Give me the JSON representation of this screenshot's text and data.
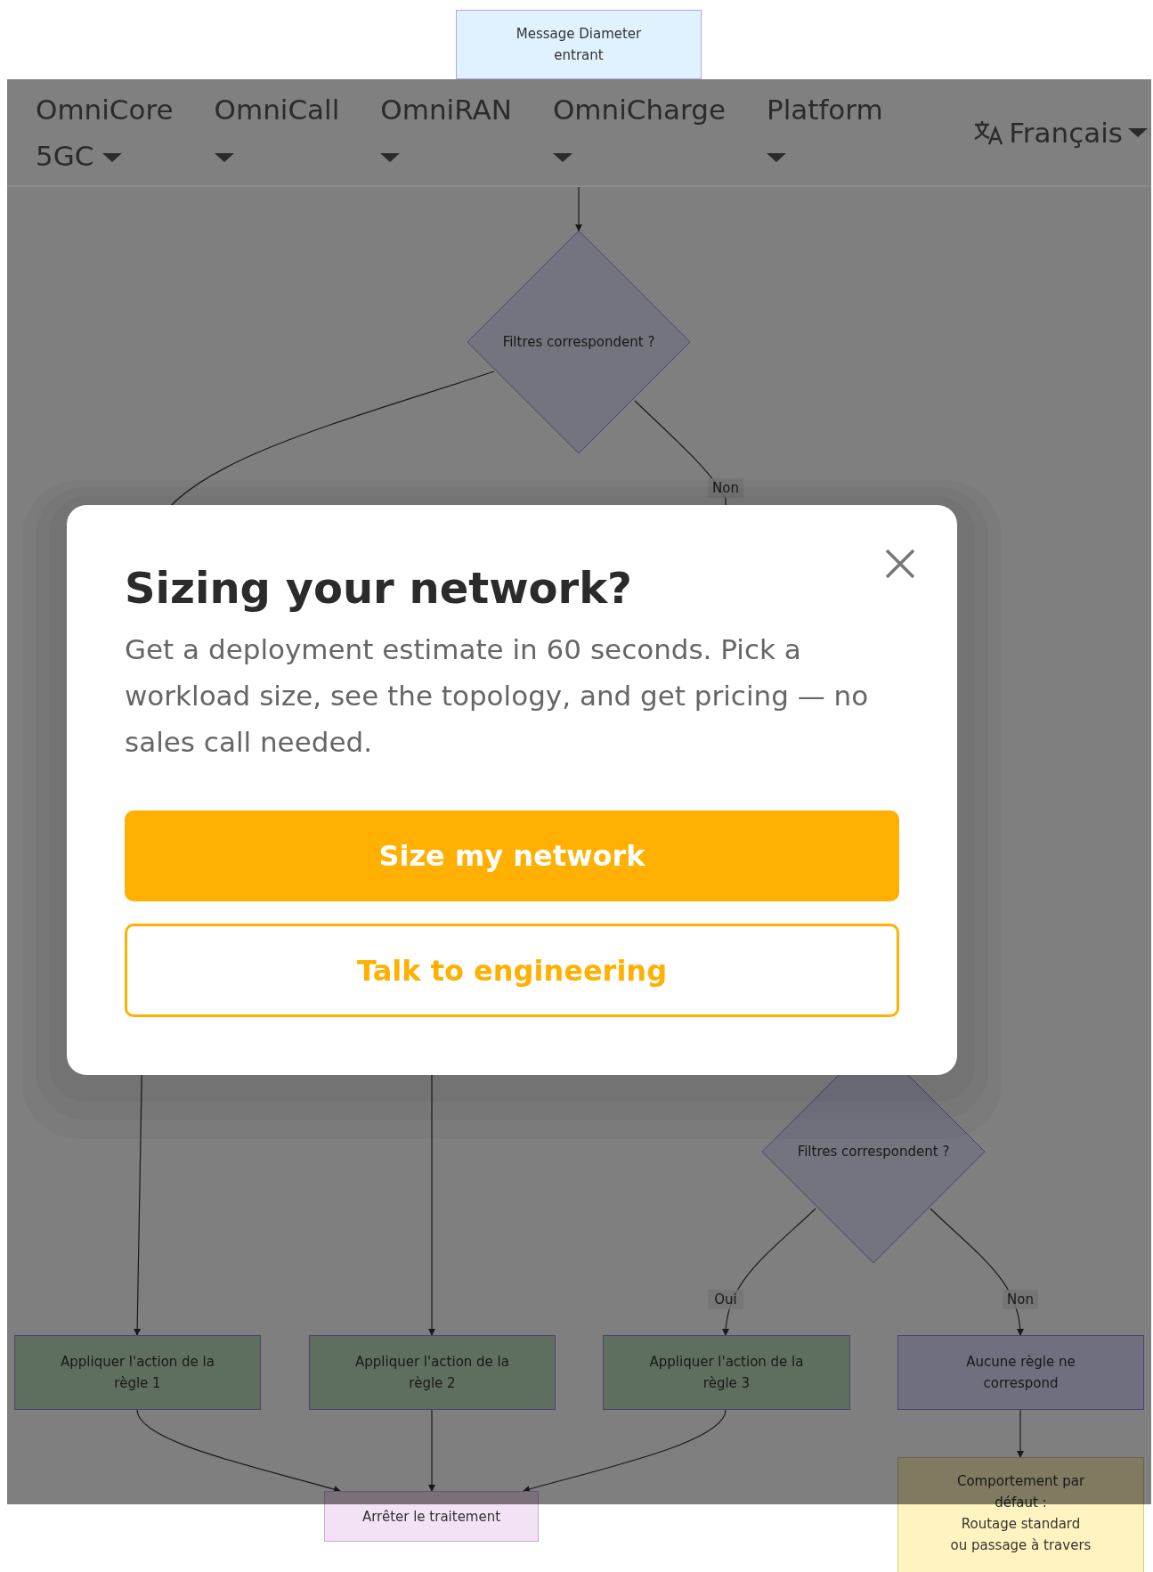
{
  "diagram": {
    "nodes": [
      {
        "kind": "start",
        "text": "Message Diameter entrant"
      },
      {
        "kind": "decision",
        "text": "Filtres correspondent ?"
      },
      {
        "kind": "decision",
        "text": "Filtres correspondent ?"
      },
      {
        "kind": "action",
        "text": "Appliquer l'action de la règle 1"
      },
      {
        "kind": "action",
        "text": "Appliquer l'action de la règle 2"
      },
      {
        "kind": "action",
        "text": "Appliquer l'action de la règle 3"
      },
      {
        "kind": "fallback",
        "text": "Aucune règle ne correspond"
      },
      {
        "kind": "stop",
        "text": "Arrêter le traitement"
      },
      {
        "kind": "default",
        "lines": [
          "Comportement par défaut :",
          "Routage standard",
          "ou passage à travers"
        ]
      }
    ],
    "edge_labels": [
      {
        "text": "Non"
      },
      {
        "text": "Oui"
      },
      {
        "text": "Non"
      }
    ]
  },
  "nav": {
    "items": [
      {
        "label": "OmniCore 5GC"
      },
      {
        "label": "OmniCall"
      },
      {
        "label": "OmniRAN"
      },
      {
        "label": "OmniCharge"
      },
      {
        "label": "Platform"
      }
    ],
    "language": {
      "label": "Français"
    }
  },
  "modal": {
    "title": "Sizing your network?",
    "body": "Get a deployment estimate in 60 seconds. Pick a workload size, see the topology, and get pricing — no sales call needed.",
    "buttons": [
      {
        "kind": "primary",
        "label": "Size my network"
      },
      {
        "kind": "secondary",
        "label": "Talk to engineering"
      }
    ]
  }
}
